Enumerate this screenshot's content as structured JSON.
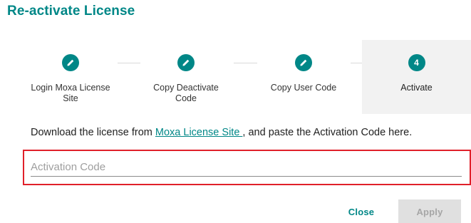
{
  "dialog": {
    "title": "Re-activate License"
  },
  "stepper": {
    "steps": [
      {
        "label": "Login Moxa License Site",
        "state": "completed",
        "icon": "pencil-icon"
      },
      {
        "label": "Copy Deactivate Code",
        "state": "completed",
        "icon": "pencil-icon"
      },
      {
        "label": "Copy User Code",
        "state": "completed",
        "icon": "pencil-icon"
      },
      {
        "label": "Activate",
        "state": "active",
        "number": "4"
      }
    ]
  },
  "instructions": {
    "before": "Download the license from ",
    "link": "Moxa License Site ",
    "after": ", and paste the Activation Code here."
  },
  "activation_field": {
    "placeholder": "Activation Code",
    "value": ""
  },
  "actions": {
    "close_label": "Close",
    "apply_label": "Apply",
    "apply_disabled": true
  },
  "colors": {
    "accent": "#008787",
    "highlight_border": "#e0202a",
    "active_step_bg": "#f2f2f2",
    "disabled_button_bg": "#e0e0e0"
  }
}
